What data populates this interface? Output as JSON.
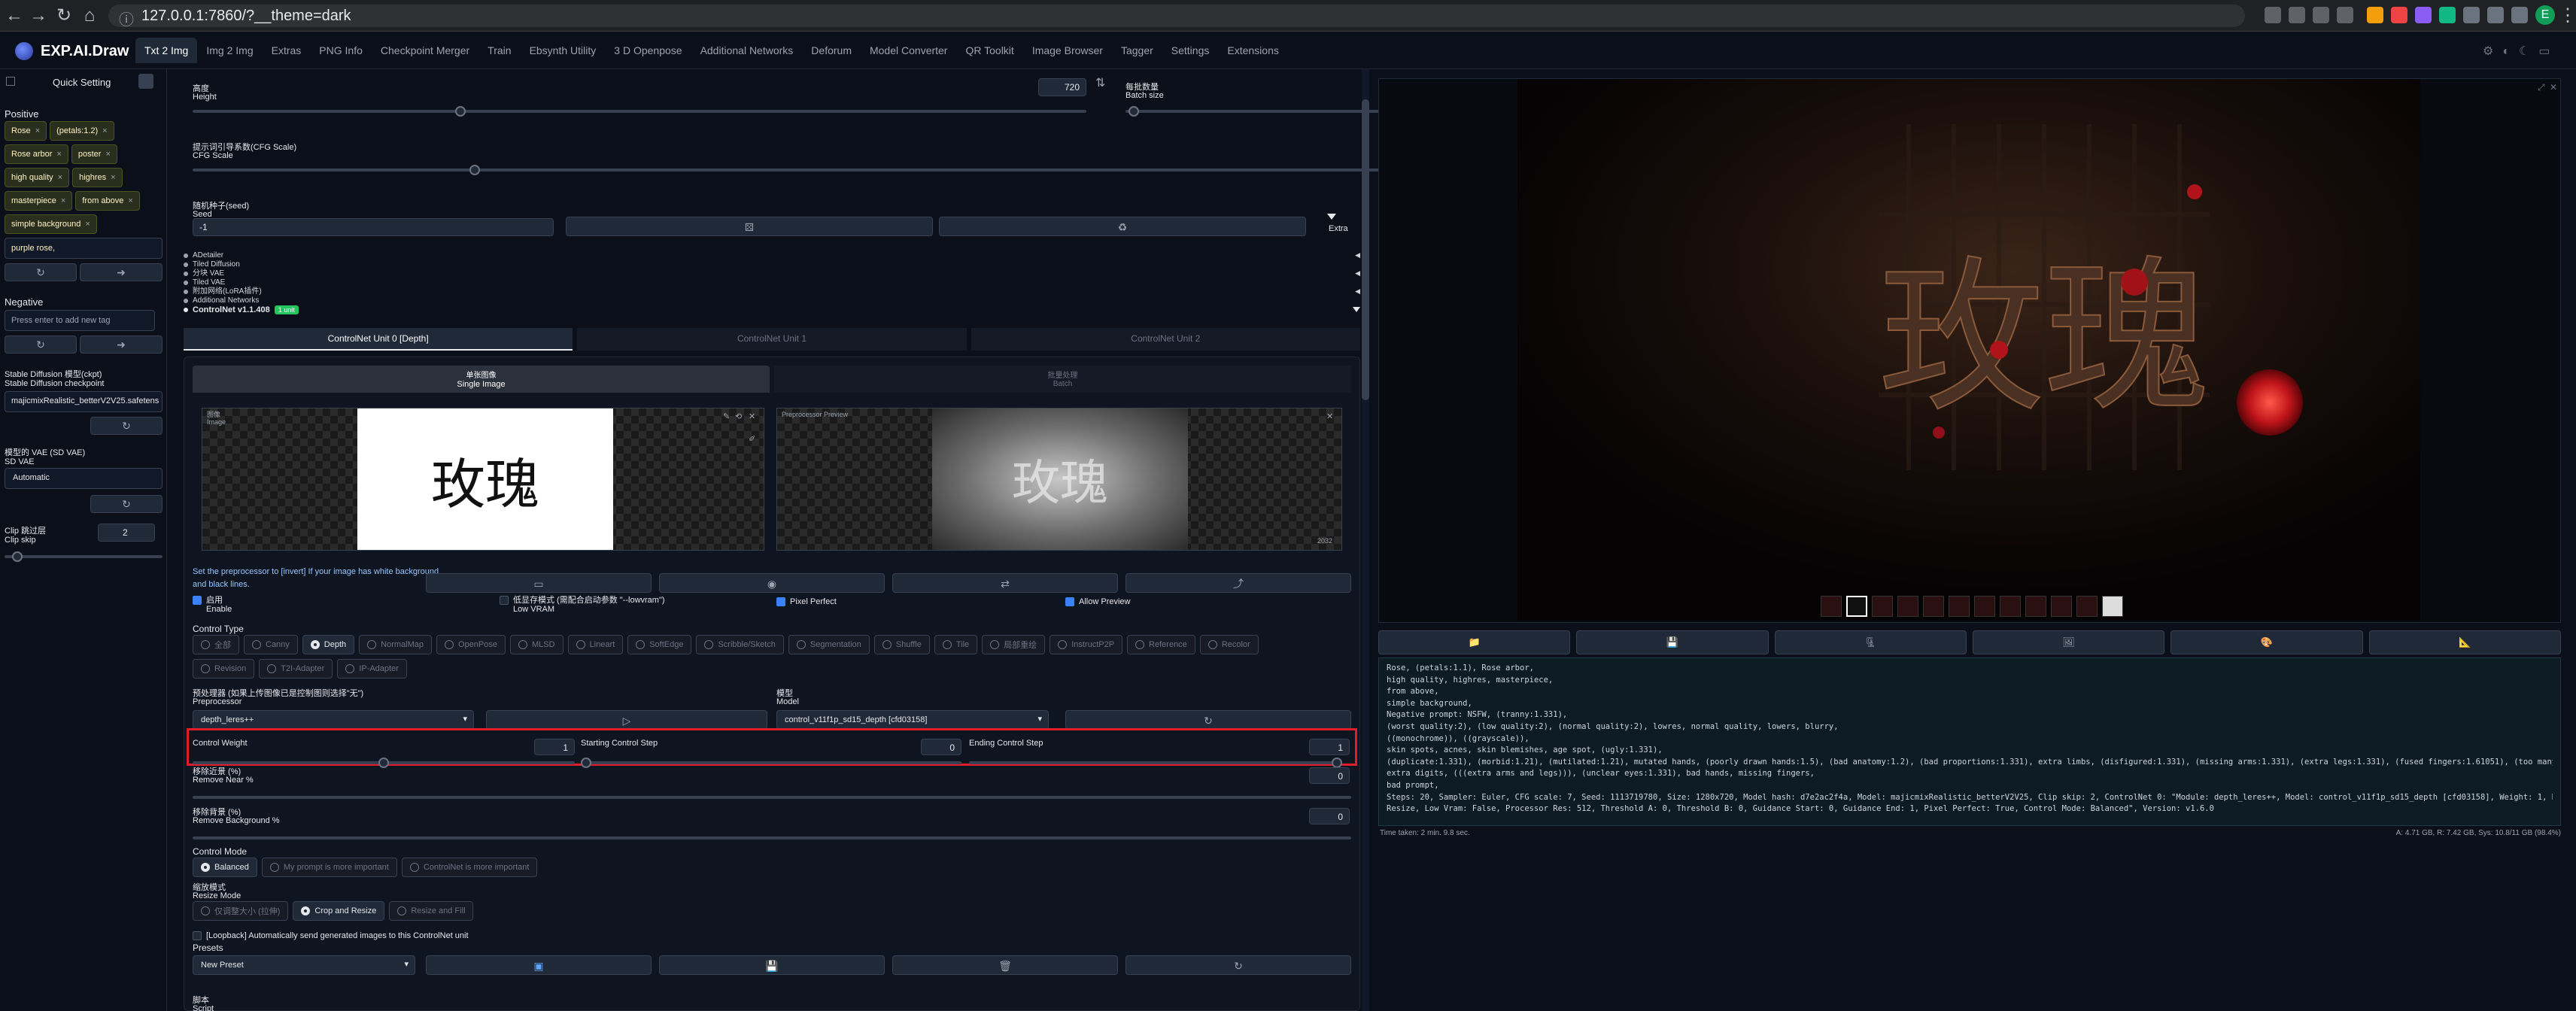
{
  "browser": {
    "url": "127.0.0.1:7860/?__theme=dark",
    "profile_initial": "E"
  },
  "app": {
    "brand": "EXP.AI.Draw",
    "tabs": [
      "Txt 2 Img",
      "Img 2 Img",
      "Extras",
      "PNG Info",
      "Checkpoint Merger",
      "Train",
      "Ebsynth Utility",
      "3 D Openpose",
      "Additional Networks",
      "Deforum",
      "Model Converter",
      "QR Toolkit",
      "Image Browser",
      "Tagger",
      "Settings",
      "Extensions"
    ],
    "active_tab": "Txt 2 Img"
  },
  "sidebar": {
    "title": "Quick Setting",
    "positive_label": "Positive",
    "positive_tags": [
      "Rose",
      "(petals:1.2)",
      "Rose arbor",
      "poster",
      "high quality",
      "highres",
      "masterpiece",
      "from above",
      "simple background"
    ],
    "positive_extra": "purple rose,",
    "negative_label": "Negative",
    "negative_placeholder": "Press enter to add new tag",
    "sd_checkpoint_label_cn": "Stable Diffusion 模型(ckpt)",
    "sd_checkpoint_label": "Stable Diffusion checkpoint",
    "sd_checkpoint_value": "majicmixRealistic_betterV2V25.safetens",
    "vae_label_cn": "模型的 VAE (SD VAE)",
    "vae_label": "SD VAE",
    "vae_value": "Automatic",
    "clip_label_cn": "Clip 跳过层",
    "clip_label": "Clip skip",
    "clip_value": "2",
    "clip_fraction": 0.08
  },
  "params": {
    "height_cn": "高度",
    "height_label": "Height",
    "height_value": "720",
    "height_fraction": 0.3,
    "batch_cn": "每批数量",
    "batch_label": "Batch size",
    "batch_value": "1",
    "batch_fraction": 0.02,
    "cfg_cn": "提示词引导系数(CFG Scale)",
    "cfg_label": "CFG Scale",
    "cfg_value": "7",
    "cfg_fraction": 0.21,
    "seed_cn": "随机种子(seed)",
    "seed_label": "Seed",
    "seed_value": "-1",
    "extra_label": "Extra"
  },
  "accordions": [
    "ADetailer",
    "Tiled Diffusion",
    "分块 VAE",
    "Tiled VAE",
    "附加网络(LoRA插件)",
    "Additional Networks"
  ],
  "controlnet": {
    "title": "ControlNet v1.1.408",
    "badge": "1 unit",
    "units": [
      "ControlNet Unit 0 [Depth]",
      "ControlNet Unit 1",
      "ControlNet Unit 2"
    ],
    "mode_tabs": [
      {
        "cn": "单张图像",
        "en": "Single Image"
      },
      {
        "cn": "批量处理",
        "en": "Batch"
      }
    ],
    "image_label_cn": "图像",
    "image_label": "Image",
    "input_text": "玫瑰",
    "preview_label": "Preprocessor Preview",
    "preview_text": "玫瑰",
    "preview_res": "2032",
    "hint": "Set the preprocessor to [invert] If your image has white background and black lines.",
    "enable_cn": "启用",
    "enable_label": "Enable",
    "lowvram_cn": "低显存模式 (需配合启动参数 \"--lowvram\")",
    "lowvram_label": "Low VRAM",
    "pixel_perfect": "Pixel Perfect",
    "allow_preview": "Allow Preview",
    "control_type_label": "Control Type",
    "control_types": [
      "全部",
      "Canny",
      "Depth",
      "NormalMap",
      "OpenPose",
      "MLSD",
      "Lineart",
      "SoftEdge",
      "Scribble/Sketch",
      "Segmentation",
      "Shuffle",
      "Tile",
      "局部重绘",
      "InstructP2P",
      "Reference",
      "Recolor",
      "Revision",
      "T2I-Adapter",
      "IP-Adapter"
    ],
    "control_type_selected": "Depth",
    "preprocessor_cn": "预处理器 (如果上传图像已是控制图则选择\"无\")",
    "preprocessor_label": "Preprocessor",
    "preprocessor_value": "depth_leres++",
    "model_cn": "模型",
    "model_label": "Model",
    "model_value": "control_v11f1p_sd15_depth [cfd03158]",
    "weight_label": "Control Weight",
    "weight_value": "1",
    "weight_fraction": 0.5,
    "start_label": "Starting Control Step",
    "start_value": "0",
    "start_fraction": 0.0,
    "end_label": "Ending Control Step",
    "end_value": "1",
    "end_fraction": 1.0,
    "remove_near_cn": "移除近景 (%)",
    "remove_near_label": "Remove Near %",
    "remove_near_value": "0",
    "remove_bg_cn": "移除背景 (%)",
    "remove_bg_label": "Remove Background %",
    "remove_bg_value": "0",
    "control_mode_label": "Control Mode",
    "control_modes": [
      "Balanced",
      "My prompt is more important",
      "ControlNet is more important"
    ],
    "control_mode_selected": "Balanced",
    "resize_cn": "缩放模式",
    "resize_label": "Resize Mode",
    "resize_modes": [
      "仅调整大小 (拉伸)",
      "Crop and Resize",
      "Resize and Fill"
    ],
    "resize_selected": "Crop and Resize",
    "loopback": "[Loopback] Automatically send generated images to this ControlNet unit",
    "presets_label": "Presets",
    "preset_value": "New Preset",
    "script_cn": "脚本",
    "script_label": "Script"
  },
  "output": {
    "image_text": "玫瑰",
    "info_lines": [
      "Rose, (petals:1.1), Rose arbor,",
      "high quality, highres, masterpiece,",
      "from above,",
      "simple background,",
      "Negative prompt: NSFW, (tranny:1.331),",
      "(worst quality:2), (low quality:2), (normal quality:2), lowres, normal quality, lowers, blurry,",
      "((monochrome)), ((grayscale)),",
      "skin spots, acnes, skin blemishes, age spot, (ugly:1.331),",
      "(duplicate:1.331), (morbid:1.21), (mutilated:1.21), mutated hands, (poorly drawn hands:1.5), (bad anatomy:1.2), (bad proportions:1.331), extra limbs, (disfigured:1.331), (missing arms:1.331), (extra legs:1.331), (fused fingers:1.61051), (too many fingers:1.61051),",
      "extra digits, (((extra arms and legs))), (unclear eyes:1.331), bad hands, missing fingers,",
      "bad prompt,",
      "Steps: 20, Sampler: Euler, CFG scale: 7, Seed: 1113719780, Size: 1280x720, Model hash: d7e2ac2f4a, Model: majicmixRealistic_betterV2V25, Clip skip: 2, ControlNet 0: \"Module: depth_leres++, Model: control_v11f1p_sd15_depth [cfd03158], Weight: 1, Resize Mode: Crop and",
      "Resize, Low Vram: False, Processor Res: 512, Threshold A: 0, Threshold B: 0, Guidance Start: 0, Guidance End: 1, Pixel Perfect: True, Control Mode: Balanced\", Version: v1.6.0"
    ],
    "time_taken": "Time taken: 2 min. 9.8 sec.",
    "vram": "A: 4.71 GB, R: 7.42 GB, Sys: 10.8/11 GB (98.4%)"
  },
  "colors": {
    "accent": "#3b82f6",
    "highlight_box": "#e11d2a",
    "badge": "#22c55e"
  }
}
